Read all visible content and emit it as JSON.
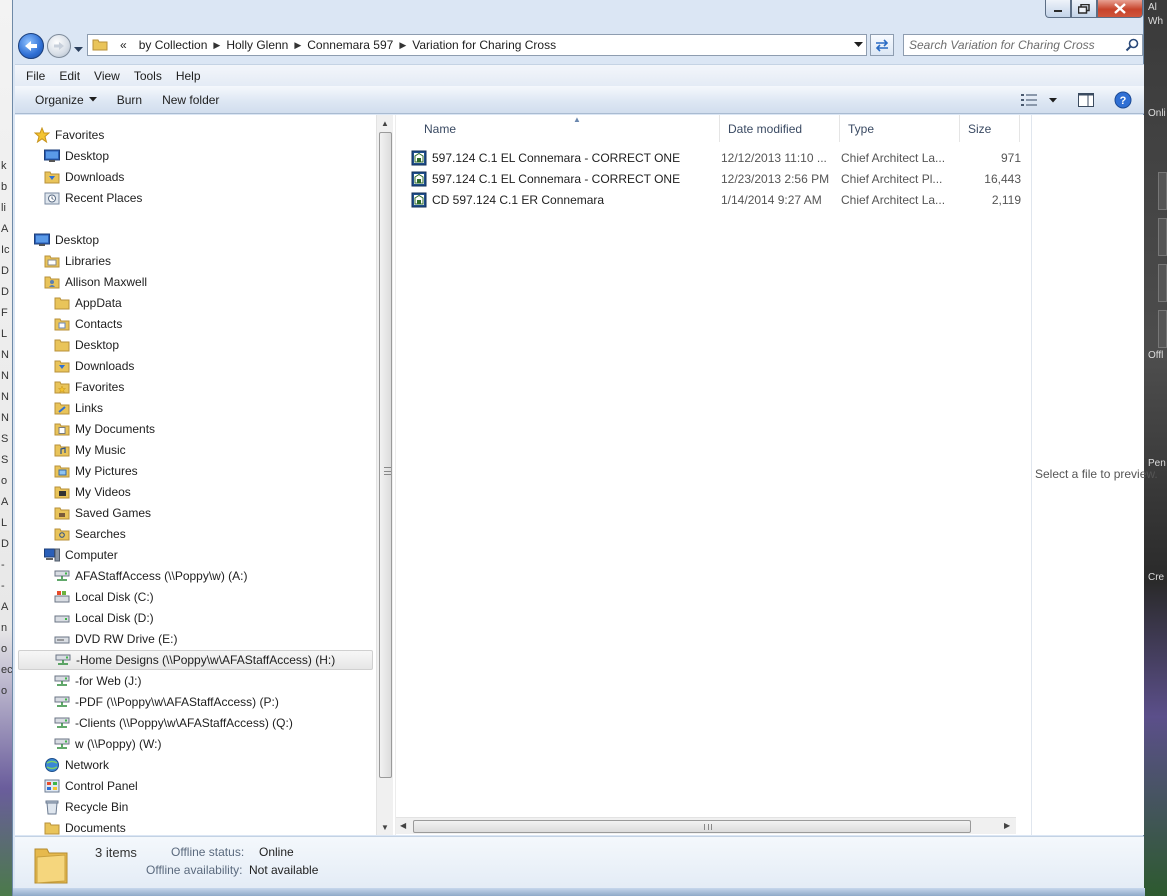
{
  "window": {
    "address": {
      "overflow": "«",
      "crumbs": [
        "by Collection",
        "Holly Glenn",
        "Connemara 597",
        "Variation for Charing Cross"
      ]
    },
    "search": {
      "placeholder": "Search Variation for Charing Cross"
    }
  },
  "menubar": {
    "items": [
      "File",
      "Edit",
      "View",
      "Tools",
      "Help"
    ]
  },
  "commandbar": {
    "organize": "Organize",
    "burn": "Burn",
    "new_folder": "New folder"
  },
  "navpane": {
    "items": [
      {
        "label": "Favorites",
        "icon": "star-icon"
      },
      {
        "label": "Desktop",
        "icon": "desktop-icon"
      },
      {
        "label": "Downloads",
        "icon": "downloads-folder-icon"
      },
      {
        "label": "Recent Places",
        "icon": "recent-places-icon"
      },
      {
        "label": "Desktop",
        "icon": "desktop-icon"
      },
      {
        "label": "Libraries",
        "icon": "libraries-icon"
      },
      {
        "label": "Allison Maxwell",
        "icon": "user-folder-icon"
      },
      {
        "label": "AppData",
        "icon": "folder-icon"
      },
      {
        "label": "Contacts",
        "icon": "contacts-folder-icon"
      },
      {
        "label": "Desktop",
        "icon": "folder-icon"
      },
      {
        "label": "Downloads",
        "icon": "downloads-folder-icon"
      },
      {
        "label": "Favorites",
        "icon": "favorites-folder-icon"
      },
      {
        "label": "Links",
        "icon": "links-folder-icon"
      },
      {
        "label": "My Documents",
        "icon": "documents-folder-icon"
      },
      {
        "label": "My Music",
        "icon": "music-folder-icon"
      },
      {
        "label": "My Pictures",
        "icon": "pictures-folder-icon"
      },
      {
        "label": "My Videos",
        "icon": "videos-folder-icon"
      },
      {
        "label": "Saved Games",
        "icon": "saved-games-folder-icon"
      },
      {
        "label": "Searches",
        "icon": "searches-folder-icon"
      },
      {
        "label": "Computer",
        "icon": "computer-icon"
      },
      {
        "label": "AFAStaffAccess (\\\\Poppy\\w) (A:)",
        "icon": "network-drive-icon"
      },
      {
        "label": "Local Disk (C:)",
        "icon": "windows-drive-icon"
      },
      {
        "label": "Local Disk (D:)",
        "icon": "local-disk-icon"
      },
      {
        "label": "DVD RW Drive (E:)",
        "icon": "dvd-drive-icon"
      },
      {
        "label": "-Home Designs (\\\\Poppy\\w\\AFAStaffAccess) (H:)",
        "icon": "network-drive-icon"
      },
      {
        "label": "-for Web (J:)",
        "icon": "network-drive-icon"
      },
      {
        "label": "-PDF (\\\\Poppy\\w\\AFAStaffAccess) (P:)",
        "icon": "network-drive-icon"
      },
      {
        "label": "-Clients (\\\\Poppy\\w\\AFAStaffAccess) (Q:)",
        "icon": "network-drive-icon"
      },
      {
        "label": "w (\\\\Poppy) (W:)",
        "icon": "network-drive-icon"
      },
      {
        "label": "Network",
        "icon": "network-icon"
      },
      {
        "label": "Control Panel",
        "icon": "control-panel-icon"
      },
      {
        "label": "Recycle Bin",
        "icon": "recycle-bin-icon"
      },
      {
        "label": "Documents",
        "icon": "folder-icon"
      }
    ],
    "selected_label": "-Home Designs (\\\\Poppy\\w\\AFAStaffAccess) (H:)"
  },
  "files": {
    "columns": [
      "Name",
      "Date modified",
      "Type",
      "Size"
    ],
    "rows": [
      {
        "name": "597.124 C.1 EL Connemara - CORRECT ONE",
        "date": "12/12/2013 11:10 ...",
        "type": "Chief Architect La...",
        "size": "971"
      },
      {
        "name": "597.124 C.1 EL Connemara - CORRECT ONE",
        "date": "12/23/2013 2:56 PM",
        "type": "Chief Architect Pl...",
        "size": "16,443"
      },
      {
        "name": "CD 597.124 C.1 ER Connemara",
        "date": "1/14/2014 9:27 AM",
        "type": "Chief Architect La...",
        "size": "2,119"
      }
    ]
  },
  "preview": {
    "message": "Select a file to preview."
  },
  "details": {
    "count": "3 items",
    "offline_status_label": "Offline status:",
    "offline_status_value": "Online",
    "offline_availability_label": "Offline availability:",
    "offline_availability_value": "Not available"
  },
  "background": {
    "left_chars": [
      "k",
      "b",
      "li",
      "A",
      "Ic",
      "D",
      "D",
      "F",
      "L",
      "N",
      "N",
      "N",
      "N",
      "S",
      "S",
      "o",
      "A",
      "L",
      "D",
      "-",
      "-",
      "A",
      "n",
      "o",
      "ec",
      "o"
    ],
    "right_texts": [
      "Al",
      "Wh",
      "Onli",
      "Offl",
      "Pen",
      "Cre"
    ]
  }
}
